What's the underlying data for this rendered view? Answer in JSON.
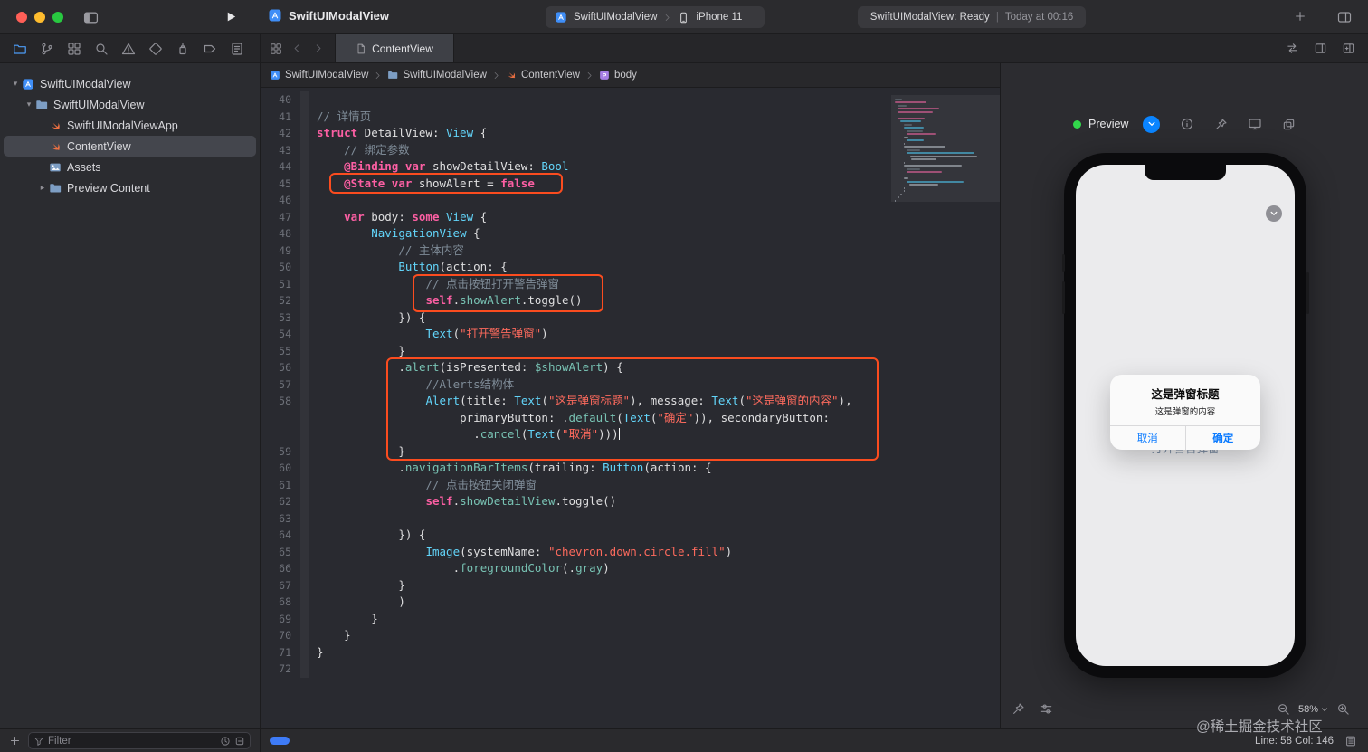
{
  "titlebar": {
    "title": "SwiftUIModalView",
    "scheme": "SwiftUIModalView",
    "device": "iPhone 11",
    "status_left": "SwiftUIModalView: Ready",
    "status_sep": "|",
    "status_right": "Today at 00:16"
  },
  "navigator_icons": [
    {
      "name": "project-navigator",
      "icon": "nav-project",
      "active": true
    },
    {
      "name": "source-control-navigator",
      "icon": "nav-vcs"
    },
    {
      "name": "symbol-navigator",
      "icon": "nav-symbol"
    },
    {
      "name": "find-navigator",
      "icon": "nav-find"
    },
    {
      "name": "issue-navigator",
      "icon": "nav-issue"
    },
    {
      "name": "test-navigator",
      "icon": "nav-test"
    },
    {
      "name": "debug-navigator",
      "icon": "nav-debug"
    },
    {
      "name": "breakpoint-navigator",
      "icon": "nav-breakpoint"
    },
    {
      "name": "report-navigator",
      "icon": "nav-report"
    }
  ],
  "tabbar": {
    "tab": "ContentView"
  },
  "jumpbar": {
    "items": [
      {
        "label": "SwiftUIModalView",
        "icon": "app-small"
      },
      {
        "label": "SwiftUIModalView",
        "icon": "folder-small"
      },
      {
        "label": "ContentView",
        "icon": "swift-small"
      },
      {
        "label": "body",
        "icon": "prop-icon"
      }
    ]
  },
  "sidebar": {
    "items": [
      {
        "label": "SwiftUIModalView",
        "icon": "app-small",
        "level": 0,
        "disclosure": "open"
      },
      {
        "label": "SwiftUIModalView",
        "icon": "folder-small",
        "level": 1,
        "disclosure": "open"
      },
      {
        "label": "SwiftUIModalViewApp",
        "icon": "swift-small",
        "level": 2
      },
      {
        "label": "ContentView",
        "icon": "swift-small",
        "level": 2,
        "selected": true
      },
      {
        "label": "Assets",
        "icon": "assets-small",
        "level": 2
      },
      {
        "label": "Preview Content",
        "icon": "folder-small",
        "level": 2,
        "disclosure": "closed"
      }
    ],
    "filter_placeholder": "Filter"
  },
  "editor": {
    "lines": [
      {
        "n": 40,
        "i": 0,
        "t": []
      },
      {
        "n": 41,
        "i": 0,
        "t": [
          [
            "c",
            "// 详情页"
          ]
        ]
      },
      {
        "n": 42,
        "i": 0,
        "t": [
          [
            "k",
            "struct"
          ],
          [
            "p",
            " DetailView: "
          ],
          [
            "t",
            "View"
          ],
          [
            "p",
            " {"
          ]
        ]
      },
      {
        "n": 43,
        "i": 4,
        "t": [
          [
            "c",
            "// 绑定参数"
          ]
        ]
      },
      {
        "n": 44,
        "i": 4,
        "t": [
          [
            "k",
            "@Binding"
          ],
          [
            "p",
            " "
          ],
          [
            "k",
            "var"
          ],
          [
            "p",
            " showDetailView: "
          ],
          [
            "t",
            "Bool"
          ]
        ]
      },
      {
        "n": 45,
        "i": 4,
        "t": [
          [
            "k",
            "@State"
          ],
          [
            "p",
            " "
          ],
          [
            "k",
            "var"
          ],
          [
            "p",
            " showAlert = "
          ],
          [
            "k",
            "false"
          ]
        ]
      },
      {
        "n": 46,
        "i": 0,
        "t": []
      },
      {
        "n": 47,
        "i": 4,
        "t": [
          [
            "k",
            "var"
          ],
          [
            "p",
            " body: "
          ],
          [
            "k",
            "some"
          ],
          [
            "p",
            " "
          ],
          [
            "t",
            "View"
          ],
          [
            "p",
            " {"
          ]
        ]
      },
      {
        "n": 48,
        "i": 8,
        "t": [
          [
            "t",
            "NavigationView"
          ],
          [
            "p",
            " {"
          ]
        ]
      },
      {
        "n": 49,
        "i": 12,
        "t": [
          [
            "c",
            "// 主体内容"
          ]
        ]
      },
      {
        "n": 50,
        "i": 12,
        "t": [
          [
            "t",
            "Button"
          ],
          [
            "p",
            "(action: {"
          ]
        ]
      },
      {
        "n": 51,
        "i": 16,
        "t": [
          [
            "c",
            "// 点击按钮打开警告弹窗"
          ]
        ]
      },
      {
        "n": 52,
        "i": 16,
        "t": [
          [
            "k",
            "self"
          ],
          [
            "p",
            "."
          ],
          [
            "m",
            "showAlert"
          ],
          [
            "p",
            ".toggle()"
          ]
        ]
      },
      {
        "n": 53,
        "i": 12,
        "t": [
          [
            "p",
            "}) {"
          ]
        ]
      },
      {
        "n": 54,
        "i": 16,
        "t": [
          [
            "t",
            "Text"
          ],
          [
            "p",
            "("
          ],
          [
            "s",
            "\"打开警告弹窗\""
          ],
          [
            "p",
            ")"
          ]
        ]
      },
      {
        "n": 55,
        "i": 12,
        "t": [
          [
            "p",
            "}"
          ]
        ]
      },
      {
        "n": 56,
        "i": 12,
        "t": [
          [
            "p",
            "."
          ],
          [
            "m",
            "alert"
          ],
          [
            "p",
            "(isPresented: "
          ],
          [
            "m",
            "$showAlert"
          ],
          [
            "p",
            ") {"
          ]
        ]
      },
      {
        "n": 57,
        "i": 16,
        "t": [
          [
            "c",
            "//Alerts结构体"
          ]
        ]
      },
      {
        "n": 58,
        "i": 16,
        "t": [
          [
            "t",
            "Alert"
          ],
          [
            "p",
            "(title: "
          ],
          [
            "t",
            "Text"
          ],
          [
            "p",
            "("
          ],
          [
            "s",
            "\"这是弹窗标题\""
          ],
          [
            "p",
            "), message: "
          ],
          [
            "t",
            "Text"
          ],
          [
            "p",
            "("
          ],
          [
            "s",
            "\"这是弹窗的内容\""
          ],
          [
            "p",
            "),"
          ]
        ]
      },
      {
        "n": null,
        "i": 21,
        "t": [
          [
            "p",
            "primaryButton: ."
          ],
          [
            "m",
            "default"
          ],
          [
            "p",
            "("
          ],
          [
            "t",
            "Text"
          ],
          [
            "p",
            "("
          ],
          [
            "s",
            "\"确定\""
          ],
          [
            "p",
            ")), secondaryButton:"
          ]
        ]
      },
      {
        "n": null,
        "i": 23,
        "t": [
          [
            "p",
            "."
          ],
          [
            "m",
            "cancel"
          ],
          [
            "p",
            "("
          ],
          [
            "t",
            "Text"
          ],
          [
            "p",
            "("
          ],
          [
            "s",
            "\"取消\""
          ],
          [
            "p",
            ")))"
          ],
          [
            "cur",
            ""
          ]
        ]
      },
      {
        "n": 59,
        "i": 12,
        "t": [
          [
            "p",
            "}"
          ]
        ]
      },
      {
        "n": 60,
        "i": 12,
        "t": [
          [
            "p",
            "."
          ],
          [
            "m",
            "navigationBarItems"
          ],
          [
            "p",
            "(trailing: "
          ],
          [
            "t",
            "Button"
          ],
          [
            "p",
            "(action: {"
          ]
        ]
      },
      {
        "n": 61,
        "i": 16,
        "t": [
          [
            "c",
            "// 点击按钮关闭弹窗"
          ]
        ]
      },
      {
        "n": 62,
        "i": 16,
        "t": [
          [
            "k",
            "self"
          ],
          [
            "p",
            "."
          ],
          [
            "m",
            "showDetailView"
          ],
          [
            "p",
            ".toggle()"
          ]
        ]
      },
      {
        "n": 63,
        "i": 0,
        "t": []
      },
      {
        "n": 64,
        "i": 12,
        "t": [
          [
            "p",
            "}) {"
          ]
        ]
      },
      {
        "n": 65,
        "i": 16,
        "t": [
          [
            "t",
            "Image"
          ],
          [
            "p",
            "(systemName: "
          ],
          [
            "s",
            "\"chevron.down.circle.fill\""
          ],
          [
            "p",
            ")"
          ]
        ]
      },
      {
        "n": 66,
        "i": 20,
        "t": [
          [
            "p",
            "."
          ],
          [
            "m",
            "foregroundColor"
          ],
          [
            "p",
            "(."
          ],
          [
            "m",
            "gray"
          ],
          [
            "p",
            ")"
          ]
        ]
      },
      {
        "n": 67,
        "i": 12,
        "t": [
          [
            "p",
            "}"
          ]
        ]
      },
      {
        "n": 68,
        "i": 12,
        "t": [
          [
            "p",
            ")"
          ]
        ]
      },
      {
        "n": 69,
        "i": 8,
        "t": [
          [
            "p",
            "}"
          ]
        ]
      },
      {
        "n": 70,
        "i": 4,
        "t": [
          [
            "p",
            "}"
          ]
        ]
      },
      {
        "n": 71,
        "i": 0,
        "t": [
          [
            "p",
            "}"
          ]
        ]
      },
      {
        "n": 72,
        "i": 0,
        "t": []
      }
    ]
  },
  "preview": {
    "label": "Preview",
    "zoom": "58%",
    "alert": {
      "title": "这是弹窗标题",
      "message": "这是弹窗的内容",
      "cancel": "取消",
      "confirm": "确定"
    },
    "background_button": "打开警告弹窗"
  },
  "statusbar": {
    "line_col": "Line: 58  Col: 146"
  },
  "watermark": "@稀土掘金技术社区",
  "colors": {
    "accent": "#3f8ef7",
    "annotation": "#fb4c1f",
    "alert_blue": "#0a7aff",
    "traffic": [
      "#ff5f57",
      "#febc2e",
      "#28c840"
    ]
  }
}
